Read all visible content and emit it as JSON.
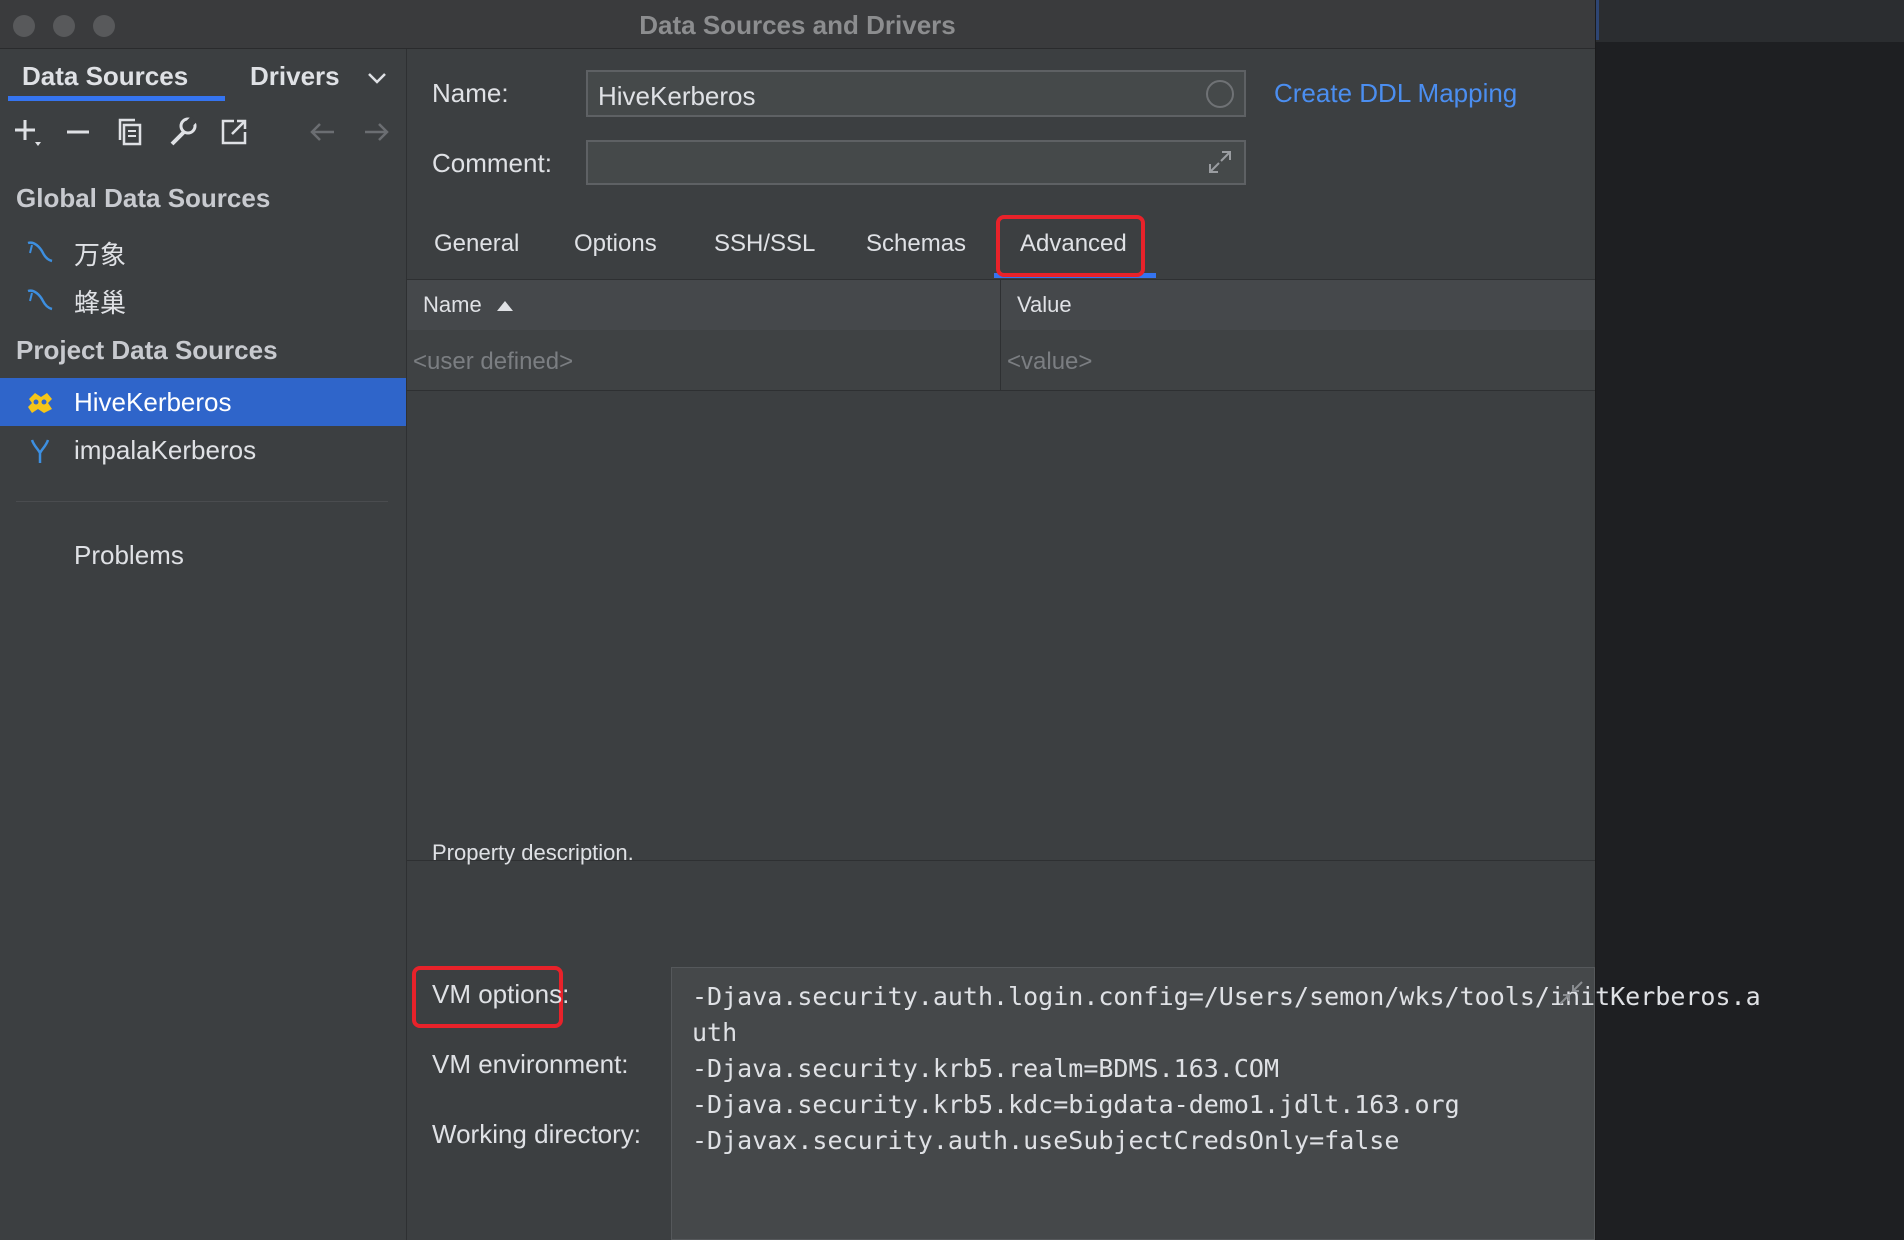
{
  "window": {
    "title": "Data Sources and Drivers"
  },
  "sidebar": {
    "tabs": [
      {
        "label": "Data Sources"
      },
      {
        "label": "Drivers"
      }
    ],
    "toolbar": [
      "add-icon",
      "remove-icon",
      "duplicate-icon",
      "wrench-icon",
      "open-external-icon",
      "back-arrow-icon",
      "forward-arrow-icon"
    ],
    "global_header": "Global Data Sources",
    "global_items": [
      {
        "label": "万象",
        "icon": "mysql-icon"
      },
      {
        "label": "蜂巢",
        "icon": "mysql-icon"
      }
    ],
    "project_header": "Project Data Sources",
    "project_items": [
      {
        "label": "HiveKerberos",
        "icon": "hive-icon",
        "selected": true
      },
      {
        "label": "impalaKerberos",
        "icon": "impala-icon",
        "selected": false
      }
    ],
    "problems_label": "Problems"
  },
  "form": {
    "name_label": "Name:",
    "name_value": "HiveKerberos",
    "comment_label": "Comment:",
    "comment_value": "",
    "ddl_link": "Create DDL Mapping"
  },
  "tabs": [
    {
      "label": "General"
    },
    {
      "label": "Options"
    },
    {
      "label": "SSH/SSL"
    },
    {
      "label": "Schemas"
    },
    {
      "label": "Advanced",
      "active": true
    }
  ],
  "table": {
    "col_name": "Name",
    "col_value": "Value",
    "name_placeholder": "<user defined>",
    "value_placeholder": "<value>"
  },
  "property_description": "Property description.",
  "vm": {
    "options_label": "VM options:",
    "environment_label": "VM environment:",
    "working_dir_label": "Working directory:",
    "lines": [
      "-Djava.security.auth.login.config=/Users/semon/wks/tools/initKerberos.a",
      "uth",
      "-Djava.security.krb5.realm=BDMS.163.COM",
      "-Djava.security.krb5.kdc=bigdata-demo1.jdlt.163.org",
      "-Djavax.security.auth.useSubjectCredsOnly=false"
    ]
  },
  "colors": {
    "accent": "#3574f0",
    "selection": "#2f65ca",
    "link": "#4b8ef0",
    "highlight": "#e8222a",
    "background": "#3c3f41"
  }
}
